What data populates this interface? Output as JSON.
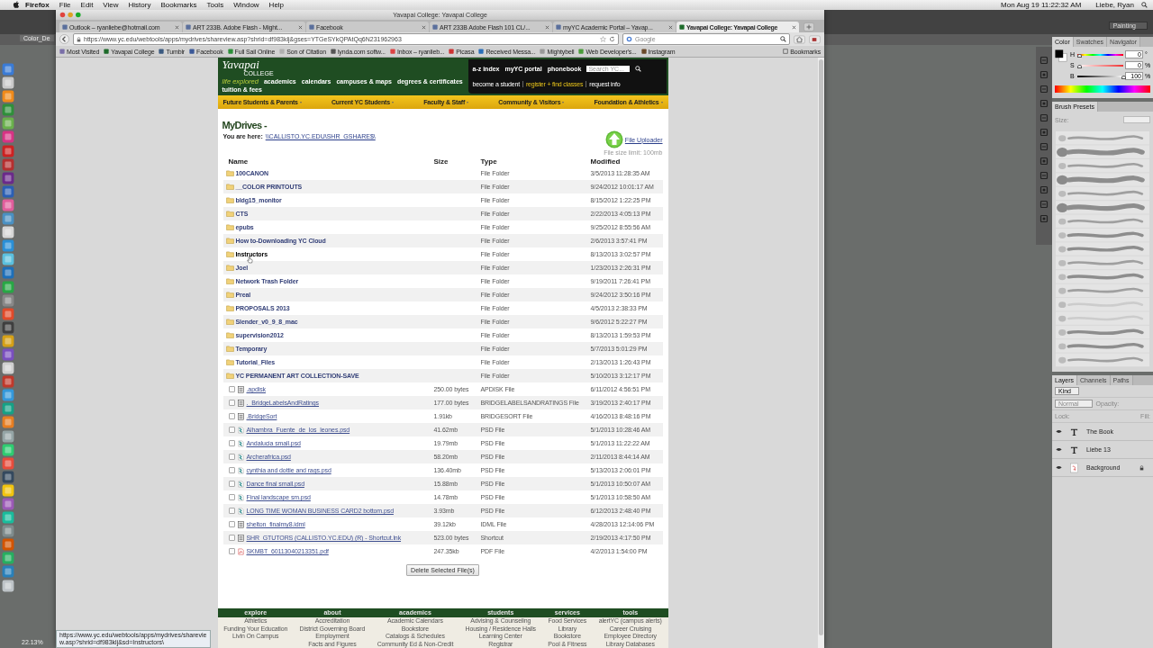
{
  "menu_bar": {
    "app": "Firefox",
    "items": [
      "File",
      "Edit",
      "View",
      "History",
      "Bookmarks",
      "Tools",
      "Window",
      "Help"
    ],
    "clock": "Mon Aug 19  11:22:32 AM",
    "user": "Liebe, Ryan"
  },
  "photoshop": {
    "workspace": "Painting",
    "document_tab": "Color_De",
    "zoom": "22.13%",
    "color_panel": {
      "tabs": [
        {
          "label": "Color",
          "selected": true
        },
        {
          "label": "Swatches",
          "selected": false
        },
        {
          "label": "Navigator",
          "selected": false
        }
      ],
      "sliders": [
        {
          "label": "H",
          "value": "0",
          "unit": "°",
          "level": 0
        },
        {
          "label": "S",
          "value": "0",
          "unit": "%",
          "level": 0
        },
        {
          "label": "B",
          "value": "100",
          "unit": "%",
          "level": 0.97
        }
      ]
    },
    "brush_panel": {
      "title": "Brush Presets",
      "size_label": "Size:"
    },
    "layers_panel": {
      "tabs": [
        {
          "label": "Layers",
          "selected": true
        },
        {
          "label": "Channels",
          "selected": false
        },
        {
          "label": "Paths",
          "selected": false
        }
      ],
      "filter": "Kind",
      "blend_mode": "Normal",
      "opacity_label": "Opacity:",
      "lock_label": "Lock:",
      "fill_label": "Fill:",
      "layers": [
        {
          "name": "The Book",
          "kind": "text",
          "visible": true,
          "locked": false
        },
        {
          "name": "Liebe 13",
          "kind": "text",
          "visible": true,
          "locked": false
        },
        {
          "name": "Background",
          "kind": "image",
          "visible": true,
          "locked": true
        }
      ]
    }
  },
  "browser": {
    "title": "Yavapai College: Yavapai College",
    "tabs": [
      {
        "label": "Outlook – ryanliebe@hotmail.com",
        "selected": false
      },
      {
        "label": "ART 233B. Adobe Flash - Might...",
        "selected": false
      },
      {
        "label": "Facebook",
        "selected": false
      },
      {
        "label": "ART 233B Adobe Flash 101 CL/...",
        "selected": false
      },
      {
        "label": "myYC Academic Portal – Yavap...",
        "selected": false
      },
      {
        "label": "Yavapai College: Yavapai College",
        "selected": true
      }
    ],
    "url": "https://www.yc.edu/webtools/apps/mydrives/shareview.asp?shrid=df983klj&gses=YTGeSYkQPAtQq6N231962963",
    "search_placeholder": "Google",
    "bookmarks": [
      "Most Visited",
      "Yavapai College",
      "Tumblr",
      "Facebook",
      "Full Sail Online",
      "Son of Citation",
      "lynda.com softw...",
      "Inbox – ryanlieb...",
      "Picasa",
      "Received Messa...",
      "Mightybell",
      "Web Developer's...",
      "Instagram"
    ],
    "bookmarks_menu": "Bookmarks",
    "status_url": "https://www.yc.edu/webtools/apps/mydrives/shareview.asp?shrid=df983klj&sd=Instructors\\"
  },
  "site": {
    "logo": "Yavapai",
    "logo_sub": "COLLEGE",
    "tagline": "life explored",
    "top_links": [
      "academics",
      "calendars",
      "campuses & maps",
      "degrees & certificates",
      "tuition & fees"
    ],
    "utility_links": [
      "a-z index",
      "myYC portal",
      "phonebook"
    ],
    "search_placeholder": "Search YC...",
    "cta_links": [
      {
        "label": "become a student",
        "highlight": false
      },
      {
        "label": "register + find classes",
        "highlight": true
      },
      {
        "label": "request info",
        "highlight": false
      }
    ],
    "nav": [
      "Future Students & Parents",
      "Current YC Students",
      "Faculty & Staff",
      "Community & Visitors",
      "Foundation & Athletics"
    ]
  },
  "page": {
    "title": "MyDrives -",
    "breadcrumb_label": "You are here:",
    "breadcrumb_path": "\\\\CALLISTO.YC.EDU\\SHR_GSHARE$\\",
    "uploader": "File Uploader",
    "size_limit": "File size limit: 100mb",
    "columns": [
      "Name",
      "Size",
      "Type",
      "Modified"
    ],
    "rows": [
      {
        "kind": "folder",
        "name": "100CANON",
        "type": "File Folder",
        "modified": "3/5/2013 11:28:35 AM",
        "hovered": false
      },
      {
        "kind": "folder",
        "name": "__COLOR PRINTOUTS",
        "type": "File Folder",
        "modified": "9/24/2012 10:01:17 AM",
        "hovered": false
      },
      {
        "kind": "folder",
        "name": "bldg15_monitor",
        "type": "File Folder",
        "modified": "8/15/2012 1:22:25 PM",
        "hovered": false
      },
      {
        "kind": "folder",
        "name": "CTS",
        "type": "File Folder",
        "modified": "2/22/2013 4:05:13 PM",
        "hovered": false
      },
      {
        "kind": "folder",
        "name": "epubs",
        "type": "File Folder",
        "modified": "9/25/2012 8:55:56 AM",
        "hovered": false
      },
      {
        "kind": "folder",
        "name": "How to-Downloading YC Cloud",
        "type": "File Folder",
        "modified": "2/6/2013 3:57:41 PM",
        "hovered": false
      },
      {
        "kind": "folder",
        "name": "Instructors",
        "type": "File Folder",
        "modified": "8/13/2013 3:02:57 PM",
        "hovered": true
      },
      {
        "kind": "folder",
        "name": "Joel",
        "type": "File Folder",
        "modified": "1/23/2013 2:26:31 PM",
        "hovered": false
      },
      {
        "kind": "folder",
        "name": "Network Trash Folder",
        "type": "File Folder",
        "modified": "9/19/2011 7:26:41 PM",
        "hovered": false
      },
      {
        "kind": "folder",
        "name": "Preal",
        "type": "File Folder",
        "modified": "9/24/2012 3:50:16 PM",
        "hovered": false
      },
      {
        "kind": "folder",
        "name": "PROPOSALS 2013",
        "type": "File Folder",
        "modified": "4/5/2013 2:38:33 PM",
        "hovered": false
      },
      {
        "kind": "folder",
        "name": "Slender_v0_9_8_mac",
        "type": "File Folder",
        "modified": "9/6/2012 5:22:27 PM",
        "hovered": false
      },
      {
        "kind": "folder",
        "name": "supervision2012",
        "type": "File Folder",
        "modified": "8/13/2013 1:59:53 PM",
        "hovered": false
      },
      {
        "kind": "folder",
        "name": "Temporary",
        "type": "File Folder",
        "modified": "5/7/2013 5:01:29 PM",
        "hovered": false
      },
      {
        "kind": "folder",
        "name": "Tutorial_Files",
        "type": "File Folder",
        "modified": "2/13/2013 1:26:43 PM",
        "hovered": false
      },
      {
        "kind": "folder",
        "name": "YC PERMANENT ART COLLECTION-SAVE",
        "type": "File Folder",
        "modified": "5/10/2013 3:12:17 PM",
        "hovered": false
      },
      {
        "kind": "file",
        "name": ".apdisk",
        "size": "250.00 bytes",
        "type": "APDISK File",
        "modified": "6/11/2012 4:56:51 PM",
        "checked": false
      },
      {
        "kind": "file",
        "name": "._BridgeLabelsAndRatings",
        "size": "177.00 bytes",
        "type": "BRIDGELABELSANDRATINGS File",
        "modified": "3/19/2013 2:40:17 PM",
        "checked": false
      },
      {
        "kind": "file",
        "name": ".BridgeSort",
        "size": "1.91kb",
        "type": "BRIDGESORT File",
        "modified": "4/16/2013 8:48:16 PM",
        "checked": false
      },
      {
        "kind": "image",
        "name": "Alhambra_Fuente_de_los_leones.psd",
        "size": "41.62mb",
        "type": "PSD File",
        "modified": "5/1/2013 10:28:46 AM",
        "checked": false
      },
      {
        "kind": "image",
        "name": "Andalucia small.psd",
        "size": "19.79mb",
        "type": "PSD File",
        "modified": "5/1/2013 11:22:22 AM",
        "checked": false
      },
      {
        "kind": "image",
        "name": "Archerafrica.psd",
        "size": "58.20mb",
        "type": "PSD File",
        "modified": "2/11/2013 8:44:14 AM",
        "checked": false
      },
      {
        "kind": "image",
        "name": "cynthia and dottie and rags.psd",
        "size": "136.40mb",
        "type": "PSD File",
        "modified": "5/13/2013 2:06:01 PM",
        "checked": false
      },
      {
        "kind": "image",
        "name": "Dance final small.psd",
        "size": "15.88mb",
        "type": "PSD File",
        "modified": "5/1/2013 10:50:07 AM",
        "checked": false
      },
      {
        "kind": "image",
        "name": "Final landscape sm.psd",
        "size": "14.78mb",
        "type": "PSD File",
        "modified": "5/1/2013 10:58:50 AM",
        "checked": false
      },
      {
        "kind": "image",
        "name": "LONG TIME WOMAN BUSINESS CARD2 bottom.psd",
        "size": "3.93mb",
        "type": "PSD File",
        "modified": "6/12/2013 2:48:40 PM",
        "checked": false
      },
      {
        "kind": "file",
        "name": "shelton_finalmy8.idml",
        "size": "39.12kb",
        "type": "IDML File",
        "modified": "4/28/2013 12:14:06 PM",
        "checked": false
      },
      {
        "kind": "file",
        "name": "SHR_GTUTORS (CALLISTO.YC.EDU) (R) - Shortcut.lnk",
        "size": "523.00 bytes",
        "type": "Shortcut",
        "modified": "2/19/2013 4:17:50 PM",
        "checked": false
      },
      {
        "kind": "pdf",
        "name": "SKMBT_60113040213351.pdf",
        "size": "247.35kb",
        "type": "PDF File",
        "modified": "4/2/2013 1:54:00 PM",
        "checked": false
      }
    ],
    "delete_button": "Delete Selected File(s)"
  },
  "footer": [
    {
      "heading": "explore",
      "links": [
        "Athletics",
        "Funding Your Education",
        "Livin On Campus"
      ]
    },
    {
      "heading": "about",
      "links": [
        "Accreditation",
        "District Governing Board",
        "Employment",
        "Facts and Figures"
      ]
    },
    {
      "heading": "academics",
      "links": [
        "Academic Calendars",
        "Bookstore",
        "Catalogs & Schedules",
        "Community Ed & Non-Credit"
      ]
    },
    {
      "heading": "students",
      "links": [
        "Advising & Counseling",
        "Housing / Residence Halls",
        "Learning Center",
        "Registrar"
      ]
    },
    {
      "heading": "services",
      "links": [
        "Food Services",
        "Library",
        "Bookstore",
        "Pool & Fitness"
      ]
    },
    {
      "heading": "tools",
      "links": [
        "alertYC (campus alerts)",
        "Career Cruising",
        "Employee Directory",
        "Library Databases"
      ]
    }
  ]
}
